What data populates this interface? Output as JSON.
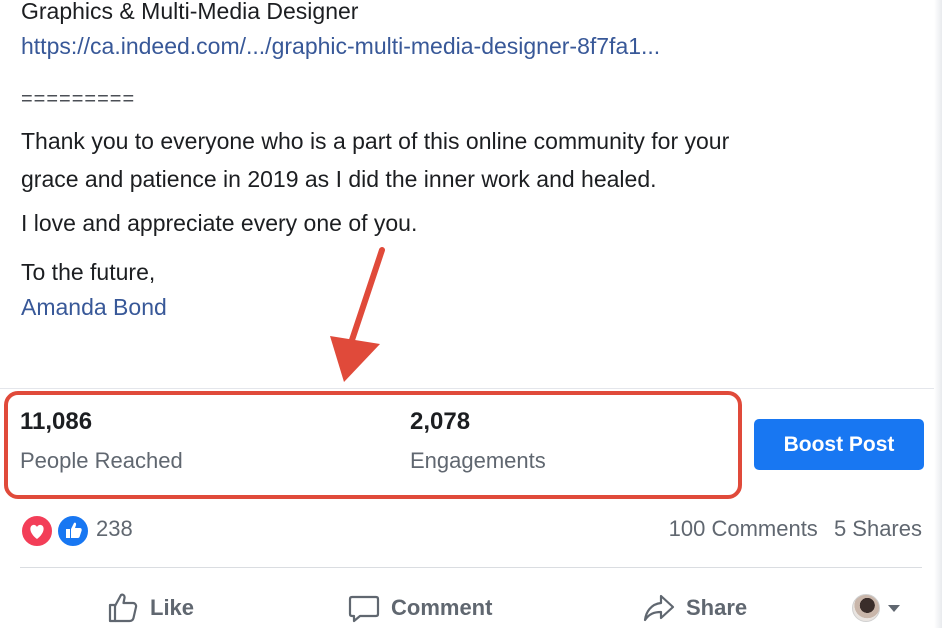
{
  "post": {
    "lines": [
      "Graphics & Multi-Media Designer",
      "https://ca.indeed.com/.../graphic-multi-media-designer-8f7fa1...",
      "=========",
      "Thank you to everyone who is a part of this online community for your",
      "grace and patience in 2019 as I did the inner work and healed.",
      "I love and appreciate every one of you.",
      "To the future,",
      "Amanda Bond"
    ]
  },
  "insights": {
    "people_reached": "11,086",
    "people_reached_label": "People Reached",
    "engagements": "2,078",
    "engagements_label": "Engagements",
    "boost_label": "Boost Post"
  },
  "reactions": {
    "count": "238",
    "comments": "100 Comments",
    "shares": "5 Shares",
    "icons": [
      "love-icon",
      "like-icon"
    ]
  },
  "actions": {
    "like": "Like",
    "comment": "Comment",
    "share": "Share"
  },
  "colors": {
    "link": "#385898",
    "highlight": "#e04a3a",
    "boost": "#1877f2",
    "love": "#f33e58",
    "like": "#1877f2"
  }
}
